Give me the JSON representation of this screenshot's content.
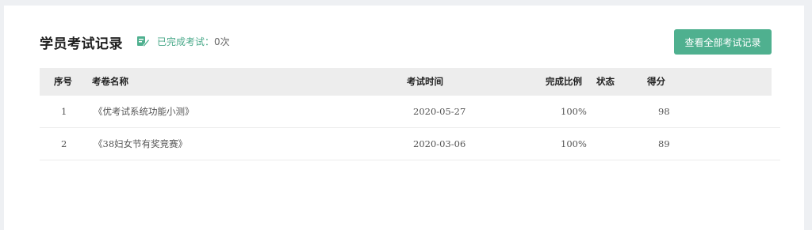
{
  "header": {
    "title": "学员考试记录",
    "completed_label": "已完成考试：",
    "completed_count": "0次",
    "view_all_button": "查看全部考试记录"
  },
  "table": {
    "columns": {
      "index": "序号",
      "name": "考卷名称",
      "time": "考试时间",
      "ratio": "完成比例",
      "status": "状态",
      "score": "得分"
    },
    "rows": [
      {
        "index": "1",
        "name": "《优考试系统功能小测》",
        "time": "2020-05-27",
        "ratio": "100%",
        "status": "",
        "score": "98"
      },
      {
        "index": "2",
        "name": "《38妇女节有奖竞赛》",
        "time": "2020-03-06",
        "ratio": "100%",
        "status": "",
        "score": "89"
      }
    ]
  },
  "colors": {
    "accent": "#4fb08f",
    "header_bg": "#ededed",
    "page_bg": "#eef0f3"
  },
  "icons": {
    "completed": "edit-note-icon"
  }
}
